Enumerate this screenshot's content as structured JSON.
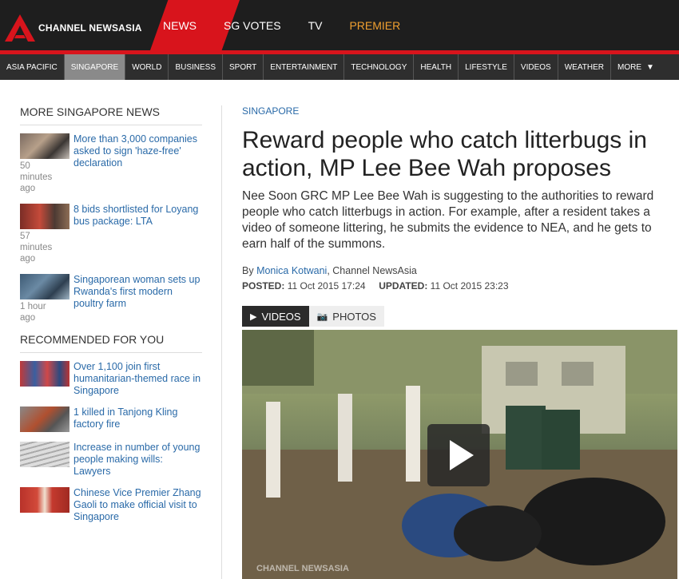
{
  "header": {
    "logo_text": "CHANNEL NEWSASIA",
    "nav": [
      "NEWS",
      "SG VOTES",
      "TV",
      "PREMIER"
    ]
  },
  "subnav": {
    "items": [
      "ASIA PACIFIC",
      "SINGAPORE",
      "WORLD",
      "BUSINESS",
      "SPORT",
      "ENTERTAINMENT",
      "TECHNOLOGY",
      "HEALTH",
      "LIFESTYLE",
      "VIDEOS",
      "WEATHER",
      "MORE"
    ],
    "active": "SINGAPORE"
  },
  "sidebar": {
    "more_title": "MORE SINGAPORE NEWS",
    "more_stories": [
      {
        "title": "More than 3,000 companies asked to sign 'haze-free' declaration",
        "time": "50 minutes ago"
      },
      {
        "title": "8 bids shortlisted for Loyang bus package: LTA",
        "time": "57 minutes ago"
      },
      {
        "title": "Singaporean woman sets up Rwanda's first modern poultry farm",
        "time": "1 hour ago"
      }
    ],
    "rec_title": "RECOMMENDED FOR YOU",
    "rec_stories": [
      {
        "title": "Over 1,100 join first humanitarian-themed race in Singapore"
      },
      {
        "title": "1 killed in Tanjong Kling factory fire"
      },
      {
        "title": "Increase in number of young people making wills: Lawyers"
      },
      {
        "title": "Chinese Vice Premier Zhang Gaoli to make official visit to Singapore"
      }
    ]
  },
  "article": {
    "category": "SINGAPORE",
    "headline": "Reward people who catch litterbugs in action, MP Lee Bee Wah proposes",
    "summary": "Nee Soon GRC MP Lee Bee Wah is suggesting to the authorities to reward people who catch litterbugs in action. For example, after a resident takes a video of someone littering, he submits the evidence to NEA, and he gets to earn half of the summons.",
    "by": "By ",
    "author": "Monica Kotwani",
    "outlet": ", Channel NewsAsia",
    "posted_label": "POSTED:",
    "posted": "11 Oct 2015 17:24",
    "updated_label": "UPDATED:",
    "updated": "11 Oct 2015 23:23",
    "tab_videos": "VIDEOS",
    "tab_photos": "PHOTOS",
    "watermark": "CHANNEL NEWSASIA"
  },
  "colors": {
    "brand_red": "#d8141c",
    "link": "#2a6aa8",
    "premier": "#f0a030"
  }
}
